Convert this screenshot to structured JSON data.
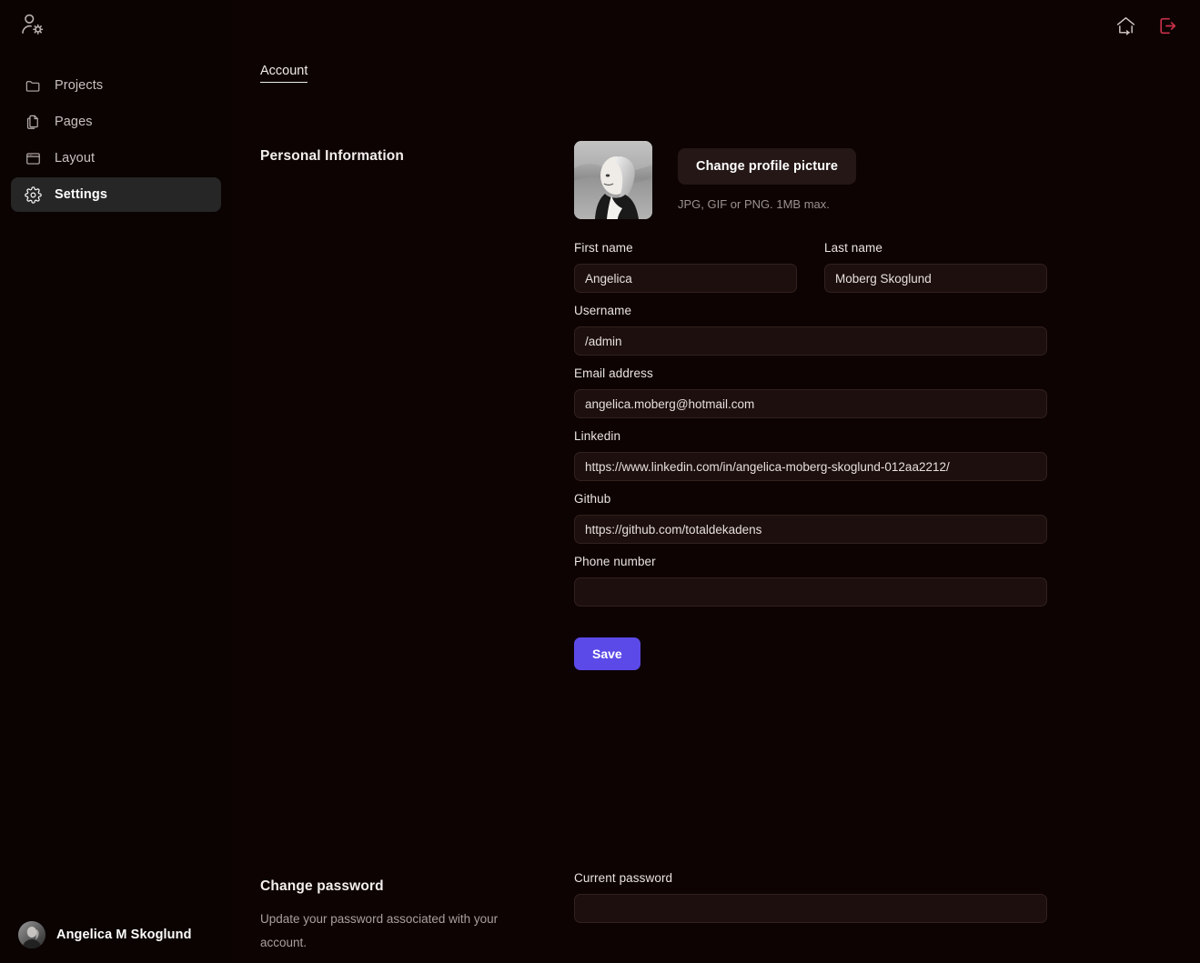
{
  "colors": {
    "background": "#0d0302",
    "sidebar_active": "#262626",
    "input_bg": "#1c0f0d",
    "input_border": "#32211e",
    "primary": "#5b4ae8",
    "ghost_button": "#241715",
    "logout": "#c8304a",
    "text": "#efeae8",
    "muted": "#a9a09d"
  },
  "sidebar": {
    "logo_icon": "user-settings-icon",
    "items": [
      {
        "label": "Projects",
        "icon": "folder-icon",
        "active": false
      },
      {
        "label": "Pages",
        "icon": "pages-icon",
        "active": false
      },
      {
        "label": "Layout",
        "icon": "layout-icon",
        "active": false
      },
      {
        "label": "Settings",
        "icon": "gear-icon",
        "active": true
      }
    ],
    "user": {
      "name": "Angelica M Skoglund",
      "avatar_alt": "avatar"
    }
  },
  "topbar": {
    "home_icon": "home-arrow-icon",
    "logout_icon": "logout-icon"
  },
  "tabs": [
    {
      "label": "Account",
      "active": true
    }
  ],
  "personal_information": {
    "title": "Personal Information",
    "picture": {
      "change_label": "Change profile picture",
      "hint": "JPG, GIF or PNG. 1MB max.",
      "alt": "profile-photo"
    },
    "fields": {
      "first_name": {
        "label": "First name",
        "value": "Angelica",
        "placeholder": ""
      },
      "last_name": {
        "label": "Last name",
        "value": "Moberg Skoglund",
        "placeholder": ""
      },
      "username": {
        "label": "Username",
        "value": "/admin",
        "placeholder": ""
      },
      "email": {
        "label": "Email address",
        "value": "angelica.moberg@hotmail.com",
        "placeholder": ""
      },
      "linkedin": {
        "label": "Linkedin",
        "value": "https://www.linkedin.com/in/angelica-moberg-skoglund-012aa2212/",
        "placeholder": ""
      },
      "github": {
        "label": "Github",
        "value": "https://github.com/totaldekadens",
        "placeholder": ""
      },
      "phone": {
        "label": "Phone number",
        "value": "",
        "placeholder": ""
      }
    },
    "save_label": "Save"
  },
  "change_password": {
    "title": "Change password",
    "description": "Update your password associated with your account.",
    "fields": {
      "current_password": {
        "label": "Current password",
        "value": "",
        "placeholder": ""
      }
    }
  }
}
